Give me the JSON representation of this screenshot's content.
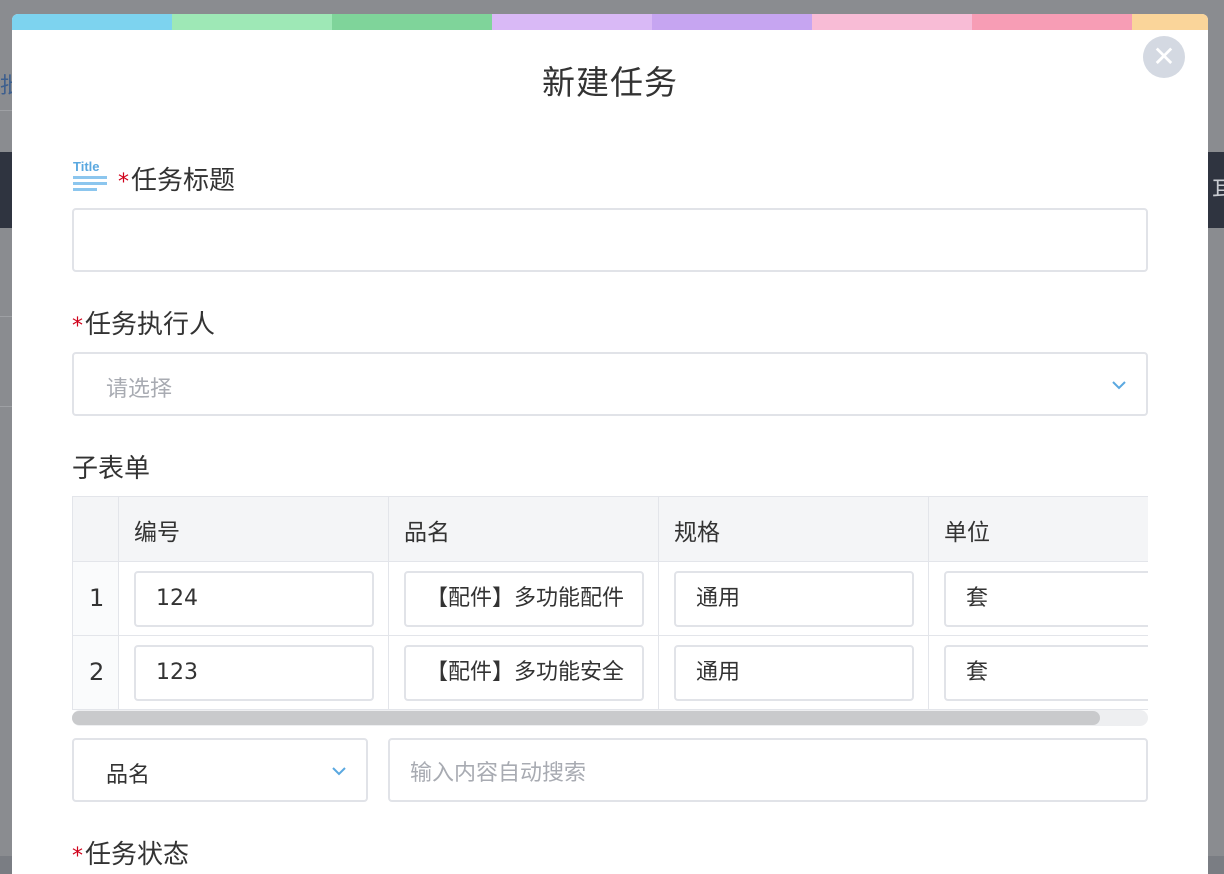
{
  "background": {
    "left_text": "批",
    "right_text": "耳"
  },
  "modal": {
    "title": "新建任务",
    "close_symbol": "✕",
    "rainbow_colors": [
      "#7dd3ef",
      "#9ee8b6",
      "#7fd49a",
      "#d9b9f6",
      "#c6a5f1",
      "#f8bcd6",
      "#f79db5",
      "#fad59a"
    ]
  },
  "fields": {
    "task_title": {
      "required_mark": "*",
      "label": "任务标题",
      "icon": "title-icon",
      "icon_text": "Title",
      "value": ""
    },
    "executor": {
      "required_mark": "*",
      "label": "任务执行人",
      "placeholder": "请选择"
    },
    "subform": {
      "label": "子表单",
      "columns": [
        "编号",
        "品名",
        "规格",
        "单位"
      ],
      "rows": [
        {
          "index": "1",
          "code": "124",
          "name": "【配件】多功能配件",
          "spec": "通用",
          "unit": "套"
        },
        {
          "index": "2",
          "code": "123",
          "name": "【配件】多功能安全",
          "spec": "通用",
          "unit": "套"
        }
      ],
      "search_field_select": "品名",
      "search_placeholder": "输入内容自动搜索"
    },
    "status": {
      "required_mark": "*",
      "label": "任务状态"
    }
  },
  "colors": {
    "accent": "#5aa8e0",
    "required": "#d0021b"
  }
}
